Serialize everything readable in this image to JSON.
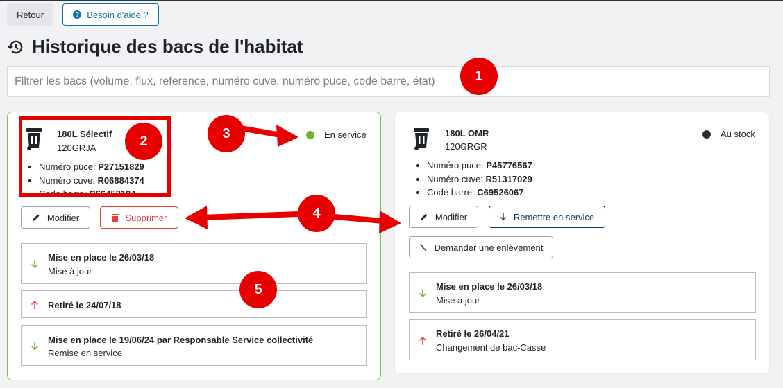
{
  "header": {
    "back_label": "Retour",
    "help_label": "Besoin d'aide ?",
    "title": "Historique des bacs de l'habitat"
  },
  "filter": {
    "placeholder": "Filtrer les bacs (volume, flux, reference, numéro cuve, numéro puce, code barre, état)"
  },
  "bins": [
    {
      "title": "180L Sélectif",
      "ref": "120GRJA",
      "status": "En service",
      "status_color": "#6fb52c",
      "props": [
        {
          "label": "Numéro puce: ",
          "value": "P27151829"
        },
        {
          "label": "Numéro cuve: ",
          "value": "R06884374"
        },
        {
          "label": "Code barre: ",
          "value": "C66453104"
        }
      ],
      "actions": {
        "modify": "Modifier",
        "delete": "Supprimer"
      },
      "history": [
        {
          "title": "Mise en place le 26/03/18",
          "sub": "Mise à jour",
          "direction": "down"
        },
        {
          "title": "Retiré le 24/07/18",
          "sub": "",
          "direction": "up"
        },
        {
          "title": "Mise en place le 19/06/24 par Responsable Service collectivité",
          "sub": "Remise en service",
          "direction": "down"
        }
      ]
    },
    {
      "title": "180L OMR",
      "ref": "120GRGR",
      "status": "Au stock",
      "status_color": "#2b2d30",
      "props": [
        {
          "label": "Numéro puce: ",
          "value": "P45776567"
        },
        {
          "label": "Numéro cuve: ",
          "value": "R51317029"
        },
        {
          "label": "Code barre: ",
          "value": "C69526067"
        }
      ],
      "actions": {
        "modify": "Modifier",
        "restore": "Remettre en service",
        "pickup": "Demander une enlèvement"
      },
      "history": [
        {
          "title": "Mise en place le 26/03/18",
          "sub": "Mise à jour",
          "direction": "down"
        },
        {
          "title": "Retiré le 26/04/21",
          "sub": "Changement de bac-Casse",
          "direction": "up"
        }
      ]
    }
  ],
  "annotations": [
    "1",
    "2",
    "3",
    "4",
    "5"
  ],
  "colors": {
    "accent": "#0a73a8",
    "valid": "#7bbf45",
    "danger": "#e0413d",
    "annotation": "#e60000",
    "arrow_down": "#6fb52c",
    "arrow_up": "#e0413d"
  }
}
